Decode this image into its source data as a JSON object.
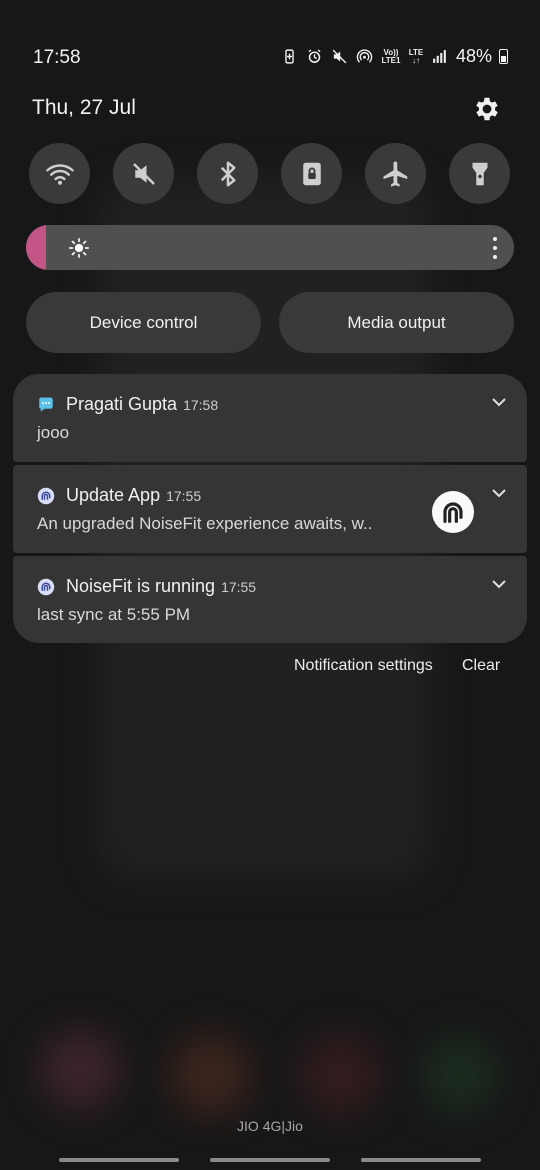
{
  "status_bar": {
    "time": "17:58",
    "volte_top": "Vo))",
    "volte_bottom": "LTE1",
    "lte_label": "LTE",
    "battery_percent": "48%",
    "icons": [
      "battery-saver-icon",
      "alarm-icon",
      "mute-icon",
      "hotspot-icon",
      "volte-icon",
      "lte-icon",
      "signal-icon",
      "battery-icon"
    ]
  },
  "header": {
    "date": "Thu, 27 Jul"
  },
  "quick_toggles": [
    {
      "name": "wifi",
      "icon": "wifi-icon"
    },
    {
      "name": "sound",
      "icon": "mute-icon"
    },
    {
      "name": "bluetooth",
      "icon": "bluetooth-icon"
    },
    {
      "name": "rotation-lock",
      "icon": "lock-icon"
    },
    {
      "name": "airplane",
      "icon": "airplane-icon"
    },
    {
      "name": "flashlight",
      "icon": "flashlight-icon"
    }
  ],
  "brightness": {
    "level": 0.04,
    "fill_color": "#c25585"
  },
  "controls": {
    "device_control": "Device control",
    "media_output": "Media output"
  },
  "notifications": [
    {
      "app": "Pragati Gupta",
      "time": "17:58",
      "text": "jooo",
      "icon": "message-icon"
    },
    {
      "app": "Update App",
      "time": "17:55",
      "text": "An upgraded NoiseFit experience awaits, w..",
      "icon": "noisefit-icon"
    },
    {
      "app": "NoiseFit is running",
      "time": "17:55",
      "text": "last sync at 5:55 PM",
      "icon": "noisefit-icon"
    }
  ],
  "notification_actions": {
    "settings": "Notification settings",
    "clear": "Clear"
  },
  "carrier": "JIO 4G|Jio",
  "colors": {
    "accent": "#c25585",
    "panel": "#353535",
    "toggle": "#3a3a3a"
  }
}
